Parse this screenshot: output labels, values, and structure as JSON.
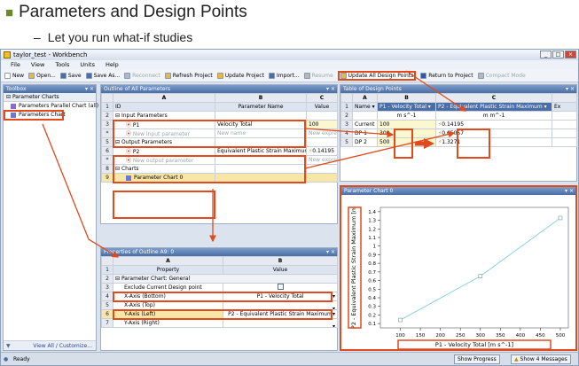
{
  "slide": {
    "title": "Parameters and Design Points",
    "subtitle_dash": "–",
    "subtitle": "Let you run what-if studies"
  },
  "window": {
    "title": "taylor_test - Workbench",
    "controls": [
      "_",
      "□",
      "×"
    ]
  },
  "menu": [
    "File",
    "View",
    "Tools",
    "Units",
    "Help"
  ],
  "toolbar": [
    {
      "label": "New",
      "icon": "new-icon",
      "color": "#ffffff"
    },
    {
      "label": "Open...",
      "icon": "open-icon",
      "color": "#e8b840"
    },
    {
      "label": "Save",
      "icon": "save-icon",
      "color": "#4a6ea6"
    },
    {
      "label": "Save As...",
      "icon": "save-as-icon",
      "color": "#4a6ea6"
    },
    {
      "label": "Reconnect",
      "icon": "reconnect-icon",
      "color": "#b0b8c0"
    },
    {
      "label": "Refresh Project",
      "icon": "refresh-icon",
      "color": "#e8b840"
    },
    {
      "label": "Update Project",
      "icon": "update-icon",
      "color": "#e8b840"
    },
    {
      "label": "Import...",
      "icon": "import-icon",
      "color": "#4a6ea6"
    },
    {
      "label": "Resume",
      "icon": "resume-icon",
      "color": "#b0b8c0"
    },
    {
      "label": "Update All Design Points",
      "icon": "update-all-icon",
      "color": "#e8b840"
    },
    {
      "label": "Return to Project",
      "icon": "return-icon",
      "color": "#2a5ab0"
    },
    {
      "label": "Compact Mode",
      "icon": "compact-icon",
      "color": "#b0b8c0"
    }
  ],
  "toolbox": {
    "header": "Toolbox",
    "group": "Parameter Charts",
    "items": [
      "Parameters Parallel Chart (all)",
      "Parameters Chart"
    ],
    "footer": "View All / Customize..."
  },
  "outline": {
    "header": "Outline of All Parameters",
    "col_letters": [
      "A",
      "B",
      "C"
    ],
    "col_headers": [
      "ID",
      "Parameter Name",
      "Value"
    ],
    "rows": [
      {
        "n": "2",
        "a": "Input Parameters",
        "b": "",
        "c": ""
      },
      {
        "n": "3",
        "a": "P1",
        "b": "Velocity Total",
        "c": "100"
      },
      {
        "n": "*",
        "a": "New input parameter",
        "b": "New name",
        "c": "New expres"
      },
      {
        "n": "5",
        "a": "Output Parameters",
        "b": "",
        "c": ""
      },
      {
        "n": "6",
        "a": "P2",
        "b": "Equivalent Plastic Strain Maximum",
        "c": "0.14195"
      },
      {
        "n": "*",
        "a": "New output parameter",
        "b": "",
        "c": "New expres"
      },
      {
        "n": "8",
        "a": "Charts",
        "b": "",
        "c": ""
      },
      {
        "n": "9",
        "a": "Parameter Chart 0",
        "b": "",
        "c": ""
      }
    ]
  },
  "properties": {
    "header": "Properties of Outline A9: 0",
    "col_letters": [
      "A",
      "B"
    ],
    "col_headers": [
      "Property",
      "Value"
    ],
    "rows": [
      {
        "n": "2",
        "a": "Parameter Chart: General",
        "b": ""
      },
      {
        "n": "3",
        "a": "Exclude Current Design point",
        "b": ""
      },
      {
        "n": "4",
        "a": "X-Axis (Bottom)",
        "b": "P1 - Velocity Total"
      },
      {
        "n": "5",
        "a": "X-Axis (Top)",
        "b": ""
      },
      {
        "n": "6",
        "a": "Y-Axis (Left)",
        "b": "P2 - Equivalent Plastic Strain Maximum"
      },
      {
        "n": "7",
        "a": "Y-Axis (Right)",
        "b": ""
      }
    ]
  },
  "design_points": {
    "header": "Table of Design Points",
    "col_letters": [
      "A",
      "B",
      "C"
    ],
    "col_headers": [
      "Name",
      "P1 - Velocity Total",
      "P2 - Equivalent Plastic Strain Maximum",
      "Ex"
    ],
    "units": [
      "",
      "m s^-1",
      "m m^-1"
    ],
    "rows": [
      {
        "n": "3",
        "name": "Current",
        "p1": "100",
        "p2": "0.14195"
      },
      {
        "n": "4",
        "name": "DP 1",
        "p1": "300",
        "p2": "0.65057"
      },
      {
        "n": "5",
        "name": "DP 2",
        "p1": "500",
        "p2": "1.3271"
      }
    ]
  },
  "chart_panel": {
    "header": "Parameter Chart 0"
  },
  "chart_data": {
    "type": "line",
    "x": [
      100,
      300,
      500
    ],
    "y": [
      0.14195,
      0.65057,
      1.3271
    ],
    "xlabel": "P1 - Velocity Total  [m s^-1]",
    "ylabel": "P2 - Equivalent Plastic Strain Maximum  [m",
    "xlim": [
      50,
      520
    ],
    "ylim": [
      0.05,
      1.45
    ],
    "xticks": [
      100,
      150,
      200,
      250,
      300,
      350,
      400,
      450,
      500
    ],
    "yticks": [
      0.1,
      0.2,
      0.3,
      0.4,
      0.5,
      0.6,
      0.7,
      0.8,
      0.9,
      1,
      1.1,
      1.2,
      1.3,
      1.4
    ],
    "color": "#7fd0e0",
    "grid": false
  },
  "status": {
    "text": "Ready",
    "progress_btn": "Show Progress",
    "messages_btn": "Show 4 Messages"
  },
  "colors": {
    "highlight": "#e04a1c",
    "header_blue": "#4a6ea6"
  }
}
